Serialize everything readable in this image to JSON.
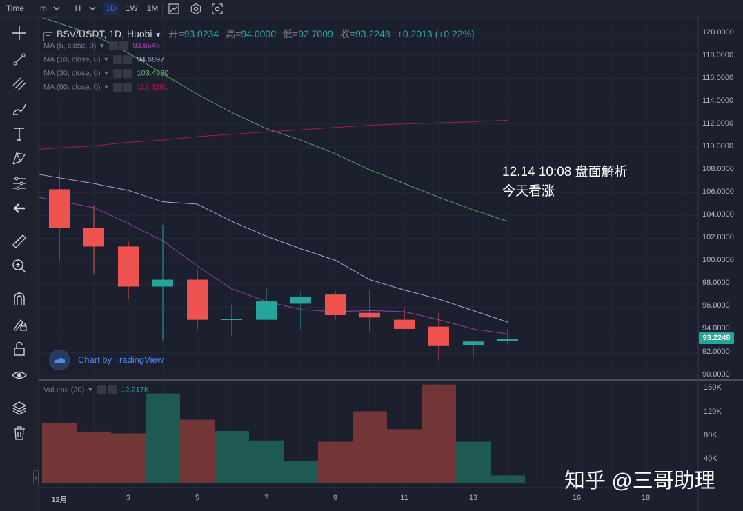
{
  "toolbar": {
    "items": [
      {
        "label": "Time"
      },
      {
        "label": "m"
      },
      {
        "label": "H"
      },
      {
        "label": "1D",
        "active": true
      },
      {
        "label": "1W"
      },
      {
        "label": "1M"
      }
    ],
    "dropdown_icon": "chevron-down-icon",
    "icons": [
      "bar-style-icon",
      "settings-icon",
      "screenshot-icon"
    ]
  },
  "sidebar": {
    "tools": [
      "crosshair-icon",
      "trendline-icon",
      "fib-icon",
      "brush-icon",
      "text-icon",
      "pattern-icon",
      "prediction-icon",
      "back-arrow-icon",
      "ruler-icon",
      "zoom-icon",
      "magnet-icon",
      "lock-drawing-icon",
      "unlock-icon",
      "eye-icon",
      "layers-icon",
      "trash-icon"
    ]
  },
  "legend": {
    "symbol": "BSV/USDT, 1D, Huobi",
    "open_label": "开=",
    "open": "93.0234",
    "high_label": "高=",
    "high": "94.0000",
    "low_label": "低=",
    "low": "92.7009",
    "close_label": "收=",
    "close": "93.2248",
    "change": "+0.2013 (+0.22%)"
  },
  "indicators": [
    {
      "name": "MA (5, close, 0)",
      "value": "93.6545",
      "color": "#ab47bc"
    },
    {
      "name": "MA (10, close, 0)",
      "value": "94.6897",
      "color": "#b8c4e8"
    },
    {
      "name": "MA (30, close, 0)",
      "value": "103.4920",
      "color": "#66bb6a"
    },
    {
      "name": "MA (60, close, 0)",
      "value": "112.3291",
      "color": "#c2185b"
    }
  ],
  "volume": {
    "name": "Volume (20)",
    "value": "12.217K"
  },
  "price_axis": [
    "120.0000",
    "118.0000",
    "116.0000",
    "114.0000",
    "112.0000",
    "110.0000",
    "108.0000",
    "106.0000",
    "104.0000",
    "102.0000",
    "100.0000",
    "98.0000",
    "96.0000",
    "94.0000",
    "92.0000",
    "90.0000"
  ],
  "last_price": "93.2248",
  "volume_axis": [
    "160K",
    "120K",
    "80K",
    "40K"
  ],
  "time_axis": [
    "12月",
    "3",
    "5",
    "7",
    "9",
    "11",
    "13",
    "16",
    "18"
  ],
  "branding": {
    "tv_text": "Chart by TradingView"
  },
  "annotation": {
    "line1": "12.14 10:08 盘面解析",
    "line2": "今天看涨"
  },
  "watermark": "知乎 @三哥助理",
  "colors": {
    "up": "#26a69a",
    "down": "#ef5350",
    "up_vol": "#1f5a52",
    "down_vol": "#733636",
    "background": "#1b1f2e",
    "grid": "#252a3a"
  },
  "chart_data": {
    "type": "candlestick",
    "price_range": [
      90,
      121
    ],
    "volume_range": [
      0,
      170000
    ],
    "candles": [
      {
        "d": "12月1",
        "o": 106.3,
        "h": 107.9,
        "l": 100.0,
        "c": 102.9,
        "v": 100000
      },
      {
        "d": "2",
        "o": 102.9,
        "h": 104.9,
        "l": 98.9,
        "c": 101.3,
        "v": 86000
      },
      {
        "d": "3",
        "o": 101.3,
        "h": 101.8,
        "l": 96.7,
        "c": 97.8,
        "v": 83000
      },
      {
        "d": "4",
        "o": 97.8,
        "h": 103.2,
        "l": 93.1,
        "c": 98.4,
        "v": 150000
      },
      {
        "d": "5",
        "o": 98.4,
        "h": 99.3,
        "l": 94.0,
        "c": 94.9,
        "v": 106000
      },
      {
        "d": "6",
        "o": 94.9,
        "h": 96.2,
        "l": 93.5,
        "c": 95.0,
        "v": 87000
      },
      {
        "d": "7",
        "o": 94.9,
        "h": 97.6,
        "l": 94.9,
        "c": 96.5,
        "v": 71000
      },
      {
        "d": "8",
        "o": 96.3,
        "h": 97.3,
        "l": 94.0,
        "c": 96.9,
        "v": 37000
      },
      {
        "d": "9",
        "o": 97.1,
        "h": 97.4,
        "l": 94.9,
        "c": 95.3,
        "v": 69000
      },
      {
        "d": "10",
        "o": 95.5,
        "h": 97.5,
        "l": 93.9,
        "c": 95.1,
        "v": 120000
      },
      {
        "d": "11",
        "o": 94.9,
        "h": 95.9,
        "l": 94.0,
        "c": 94.1,
        "v": 90000
      },
      {
        "d": "12",
        "o": 94.3,
        "h": 95.5,
        "l": 91.3,
        "c": 92.6,
        "v": 165000
      },
      {
        "d": "13",
        "o": 92.7,
        "h": 93.1,
        "l": 91.7,
        "c": 93.0,
        "v": 69000
      },
      {
        "d": "14",
        "o": 93.0234,
        "h": 94.0,
        "l": 92.7009,
        "c": 93.2248,
        "v": 12217
      }
    ],
    "ma": {
      "MA5": [
        105.6,
        104.7,
        103.3,
        101.8,
        99.6,
        97.6,
        96.5,
        95.8,
        95.6,
        95.7,
        95.6,
        94.9,
        94.1,
        93.6545
      ],
      "MA10": [
        107.6,
        106.8,
        106.2,
        105.2,
        105.0,
        103.5,
        102.2,
        101.1,
        100.1,
        98.4,
        97.5,
        96.7,
        95.7,
        94.6897
      ],
      "MA30": [
        121.4,
        119.8,
        118.2,
        116.4,
        114.6,
        113.0,
        111.6,
        110.6,
        109.4,
        108.0,
        106.8,
        105.6,
        104.5,
        103.492
      ],
      "MA60": [
        109.8,
        110.1,
        110.4,
        110.6,
        110.9,
        111.1,
        111.3,
        111.5,
        111.7,
        111.9,
        112.0,
        112.1,
        112.2,
        112.3291
      ]
    }
  }
}
